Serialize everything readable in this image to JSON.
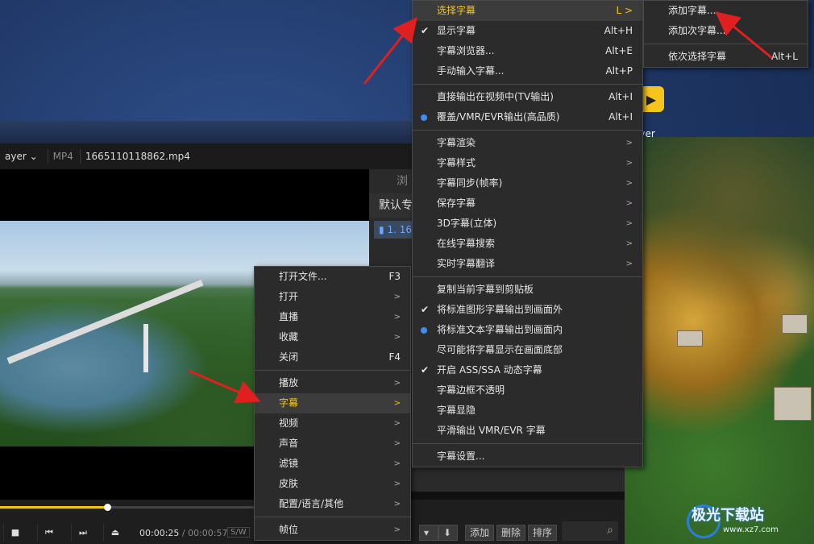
{
  "desktop": {
    "icon_label": "ayer",
    "icon_badge": "ayer"
  },
  "player": {
    "brand": "ayer",
    "format": "MP4",
    "file_name": "1665110118862.mp4",
    "side_tab": "浏",
    "side_header": "默认专",
    "side_item": "1. 16",
    "time_current": "00:00:25",
    "time_total": "/ 00:00:57",
    "sw": "S/W",
    "progress": 0.29,
    "list_buttons": [
      "添加",
      "删除",
      "排序"
    ]
  },
  "main_menu": {
    "items": [
      {
        "label": "打开文件...",
        "shortcut": "F3"
      },
      {
        "label": "打开",
        "arrow": ">"
      },
      {
        "label": "直播",
        "arrow": ">"
      },
      {
        "label": "收藏",
        "arrow": ">"
      },
      {
        "label": "关闭",
        "shortcut": "F4"
      },
      {
        "label": "播放",
        "arrow": ">"
      },
      {
        "label": "字幕",
        "arrow": ">"
      },
      {
        "label": "视频",
        "arrow": ">"
      },
      {
        "label": "声音",
        "arrow": ">"
      },
      {
        "label": "滤镜",
        "arrow": ">"
      },
      {
        "label": "皮肤",
        "arrow": ">"
      },
      {
        "label": "配置/语言/其他",
        "arrow": ">"
      },
      {
        "label": "帧位",
        "arrow": ">"
      }
    ]
  },
  "subtitle_menu": {
    "items": [
      {
        "label": "选择字幕",
        "shortcut": "L >"
      },
      {
        "label": "显示字幕",
        "shortcut": "Alt+H"
      },
      {
        "label": "字幕浏览器...",
        "shortcut": "Alt+E"
      },
      {
        "label": "手动输入字幕...",
        "shortcut": "Alt+P"
      },
      {
        "label": "直接输出在视频中(TV输出)",
        "shortcut": "Alt+I"
      },
      {
        "label": "覆盖/VMR/EVR输出(高品质)",
        "shortcut": "Alt+I"
      },
      {
        "label": "字幕渲染",
        "arrow": ">"
      },
      {
        "label": "字幕样式",
        "arrow": ">"
      },
      {
        "label": "字幕同步(帧率)",
        "arrow": ">"
      },
      {
        "label": "保存字幕",
        "arrow": ">"
      },
      {
        "label": "3D字幕(立体)",
        "arrow": ">"
      },
      {
        "label": "在线字幕搜索",
        "arrow": ">"
      },
      {
        "label": "实时字幕翻译",
        "arrow": ">"
      },
      {
        "label": "复制当前字幕到剪贴板"
      },
      {
        "label": "将标准图形字幕输出到画面外"
      },
      {
        "label": "将标准文本字幕输出到画面内"
      },
      {
        "label": "尽可能将字幕显示在画面底部"
      },
      {
        "label": "开启 ASS/SSA 动态字幕"
      },
      {
        "label": "字幕边框不透明"
      },
      {
        "label": "字幕显隐"
      },
      {
        "label": "平滑输出 VMR/EVR 字幕"
      },
      {
        "label": "字幕设置..."
      }
    ]
  },
  "select_menu": {
    "items": [
      {
        "label": "添加字幕..."
      },
      {
        "label": "添加次字幕..."
      },
      {
        "label": "依次选择字幕",
        "shortcut": "Alt+L"
      }
    ]
  },
  "marks": {
    "check": "✔"
  },
  "watermark": {
    "title": "极光下载站",
    "url": "www.xz7.com"
  },
  "colors": {
    "accent": "#f5c518",
    "radio": "#3d8ef0",
    "arrow": "#e02020"
  }
}
